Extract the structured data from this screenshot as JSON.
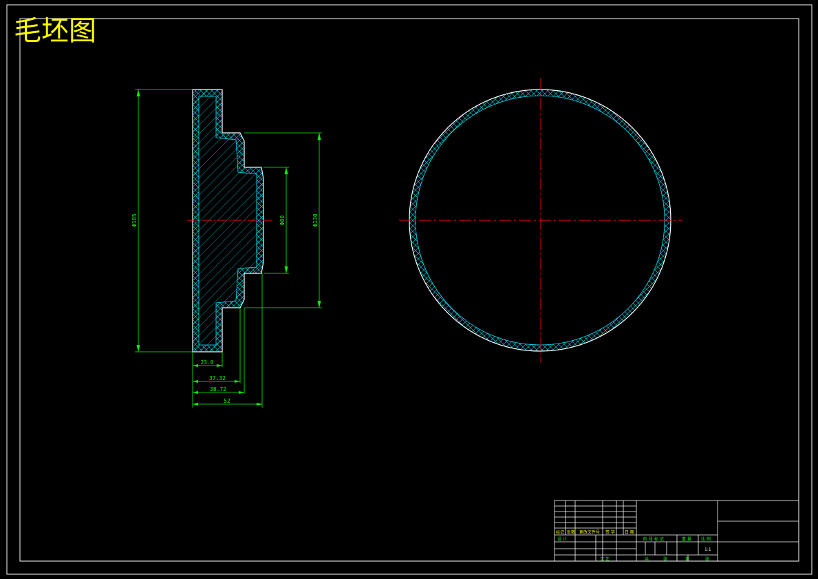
{
  "title": "毛坯图",
  "colors": {
    "background": "#000000",
    "frame": "#ffffff",
    "dimension": "#00ff00",
    "outline": "#ffffff",
    "hatch": "#00e5ff",
    "centerline": "#ff0000",
    "title": "#ffff00",
    "titleblock_text": "#00ff00",
    "titleblock_label": "#ffff00"
  },
  "section_view": {
    "diameters": {
      "outer": "Φ185",
      "middle": "Φ130",
      "inner": "Φ80"
    },
    "lengths": {
      "flange": "23.0",
      "step1": "37.32",
      "step2": "38.72",
      "total": "52"
    }
  },
  "title_block": {
    "row_labels": [
      "标记",
      "处数",
      "更改文件号",
      "签 字",
      "日 期"
    ],
    "design": "设 计",
    "stage": "阶 段 标 记",
    "weight": "重 量",
    "scale_label": "比 例",
    "scale": "1:1",
    "audit": "审 核",
    "process": "工 艺",
    "date": "日 期",
    "sheet_total": "共",
    "sheet_label": "张",
    "sheet_no": "第",
    "sheet_label2": "张"
  }
}
